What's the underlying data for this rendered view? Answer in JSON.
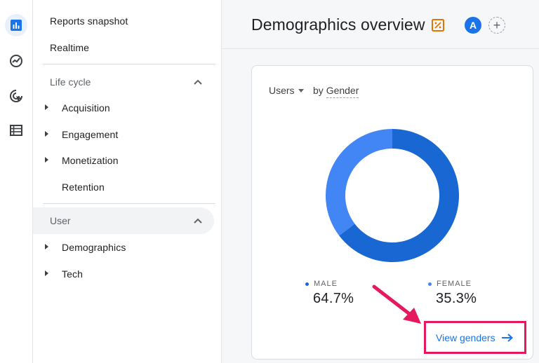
{
  "rail": {
    "items": [
      {
        "icon": "bar-chart-icon",
        "active": true
      },
      {
        "icon": "explore-trend-icon",
        "active": false
      },
      {
        "icon": "advertising-target-icon",
        "active": false
      },
      {
        "icon": "list-icon",
        "active": false
      }
    ]
  },
  "nav": {
    "reports_snapshot": "Reports snapshot",
    "realtime": "Realtime",
    "lifecycle": {
      "title": "Life cycle",
      "items": [
        "Acquisition",
        "Engagement",
        "Monetization",
        "Retention"
      ]
    },
    "user": {
      "title": "User",
      "items": [
        "Demographics",
        "Tech"
      ]
    }
  },
  "header": {
    "title": "Demographics overview",
    "avatar_letter": "A",
    "add_symbol": "+"
  },
  "card": {
    "metric": "Users",
    "by_prefix": "by",
    "dimension": "Gender",
    "link_label": "View genders",
    "link_arrow": "→"
  },
  "colors": {
    "male": "#1967d2",
    "female": "#4285f4",
    "accent": "#1a73e8",
    "highlight": "#e6195f"
  },
  "chart_data": {
    "type": "pie",
    "categories": [
      "MALE",
      "FEMALE"
    ],
    "values": [
      64.7,
      35.3
    ],
    "labels": [
      "64.7%",
      "35.3%"
    ]
  }
}
